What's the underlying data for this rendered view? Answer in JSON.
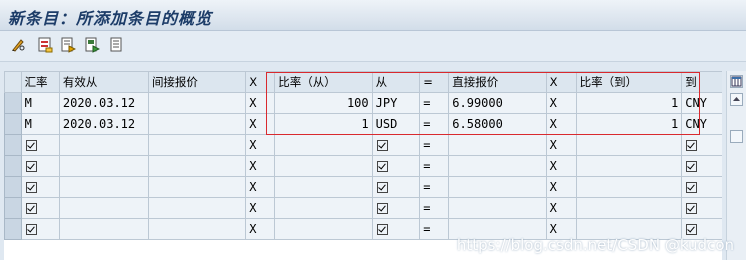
{
  "window": {
    "title": "新条目：所添加条目的概览"
  },
  "toolbar": {
    "buttons": [
      {
        "icon": "pencil-glasses-icon"
      },
      {
        "icon": "new-entries-icon"
      },
      {
        "icon": "copy-as-icon"
      },
      {
        "icon": "save-icon"
      },
      {
        "icon": "document-icon"
      }
    ]
  },
  "table": {
    "headers": [
      "汇率",
      "有效从",
      "间接报价",
      "X",
      "比率（从）",
      "从",
      "=",
      "直接报价",
      "X",
      "比率（到）",
      "到"
    ],
    "rows": [
      {
        "rate_type": "M",
        "valid_from": "2020.03.12",
        "indirect": "",
        "x1": "X",
        "ratio_from": "100",
        "from": "JPY",
        "eq": "=",
        "direct": "6.99000",
        "x2": "X",
        "ratio_to": "1",
        "to": "CNY"
      },
      {
        "rate_type": "M",
        "valid_from": "2020.03.12",
        "indirect": "",
        "x1": "X",
        "ratio_from": "1",
        "from": "USD",
        "eq": "=",
        "direct": "6.58000",
        "x2": "X",
        "ratio_to": "1",
        "to": "CNY"
      },
      {
        "rate_type": "",
        "valid_from": "",
        "indirect": "",
        "x1": "X",
        "ratio_from": "",
        "from": "",
        "eq": "=",
        "direct": "",
        "x2": "X",
        "ratio_to": "",
        "to": ""
      },
      {
        "rate_type": "",
        "valid_from": "",
        "indirect": "",
        "x1": "X",
        "ratio_from": "",
        "from": "",
        "eq": "=",
        "direct": "",
        "x2": "X",
        "ratio_to": "",
        "to": ""
      },
      {
        "rate_type": "",
        "valid_from": "",
        "indirect": "",
        "x1": "X",
        "ratio_from": "",
        "from": "",
        "eq": "=",
        "direct": "",
        "x2": "X",
        "ratio_to": "",
        "to": ""
      },
      {
        "rate_type": "",
        "valid_from": "",
        "indirect": "",
        "x1": "X",
        "ratio_from": "",
        "from": "",
        "eq": "=",
        "direct": "",
        "x2": "X",
        "ratio_to": "",
        "to": ""
      },
      {
        "rate_type": "",
        "valid_from": "",
        "indirect": "",
        "x1": "X",
        "ratio_from": "",
        "from": "",
        "eq": "=",
        "direct": "",
        "x2": "X",
        "ratio_to": "",
        "to": ""
      }
    ]
  },
  "highlight_color": "#d9292e",
  "watermark": "https://blog.csdn.net/CSDN @kudcon"
}
